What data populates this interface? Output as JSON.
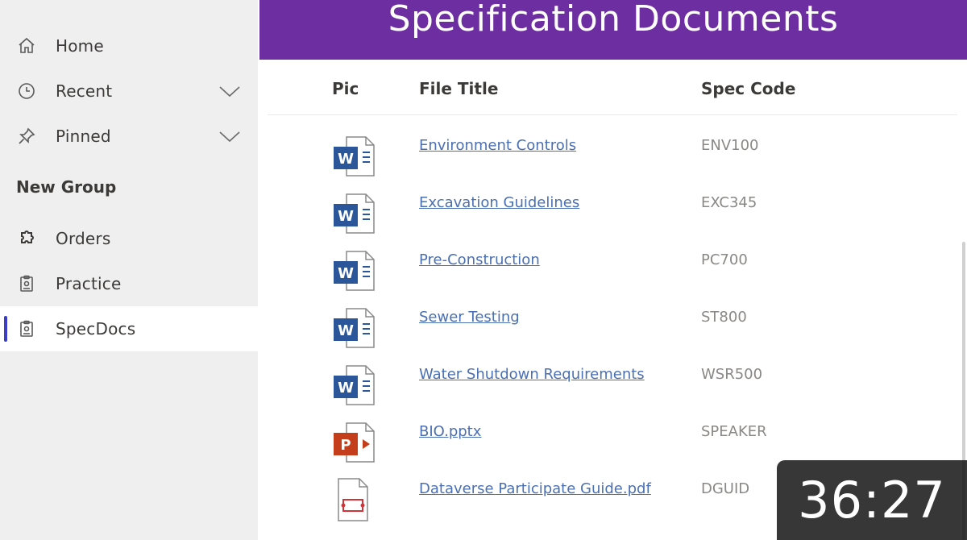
{
  "sidebar": {
    "items": [
      {
        "label": "Home",
        "icon": "home-icon"
      },
      {
        "label": "Recent",
        "icon": "clock-icon",
        "expandable": true
      },
      {
        "label": "Pinned",
        "icon": "pin-icon",
        "expandable": true
      }
    ],
    "group_header": "New Group",
    "group_items": [
      {
        "label": "Orders",
        "icon": "puzzle-icon"
      },
      {
        "label": "Practice",
        "icon": "clipboard-icon"
      },
      {
        "label": "SpecDocs",
        "icon": "clipboard-icon",
        "selected": true
      }
    ]
  },
  "banner": {
    "title": "Specification Documents",
    "color": "#6c2ea0"
  },
  "table": {
    "columns": [
      "Pic",
      "File Title",
      "Spec Code"
    ],
    "rows": [
      {
        "type": "word",
        "title": "Environment Controls",
        "code": "ENV100"
      },
      {
        "type": "word",
        "title": "Excavation Guidelines",
        "code": "EXC345"
      },
      {
        "type": "word",
        "title": "Pre-Construction",
        "code": "PC700"
      },
      {
        "type": "word",
        "title": "Sewer Testing",
        "code": "ST800"
      },
      {
        "type": "word",
        "title": "Water Shutdown Requirements",
        "code": "WSR500"
      },
      {
        "type": "powerpoint",
        "title": "BIO.pptx",
        "code": "SPEAKER"
      },
      {
        "type": "pdf",
        "title": "Dataverse Participate Guide.pdf",
        "code": "DGUID"
      }
    ]
  },
  "overlay": {
    "timestamp": "36:27"
  },
  "colors": {
    "word_blue": "#2b579a",
    "ppt_orange": "#c43e1c",
    "pdf_red": "#d13438",
    "link_blue": "#4a6fb3",
    "selected_marker": "#3b3cc8"
  }
}
